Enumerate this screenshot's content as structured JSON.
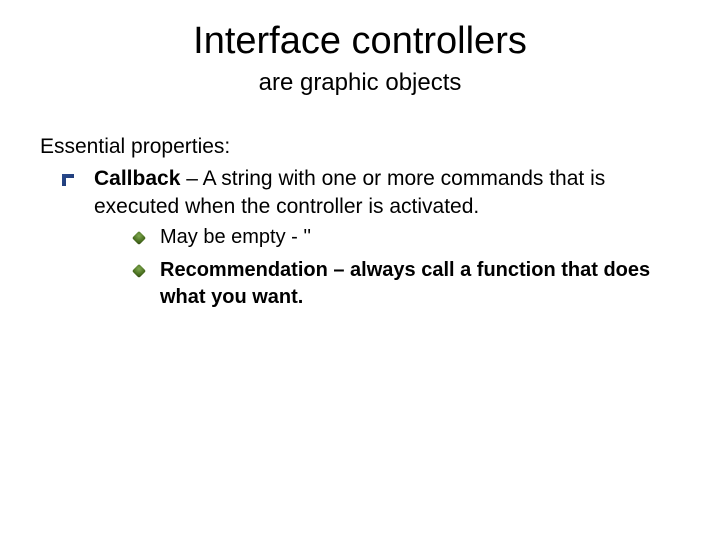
{
  "title": "Interface controllers",
  "subtitle": "are graphic objects",
  "intro": "Essential properties:",
  "item1": {
    "label": "Callback",
    "desc": " – A string with one or more commands that is executed when the controller is activated."
  },
  "sub1": "May be empty - ''",
  "sub2": "Recommendation – always call a function that does what you want."
}
